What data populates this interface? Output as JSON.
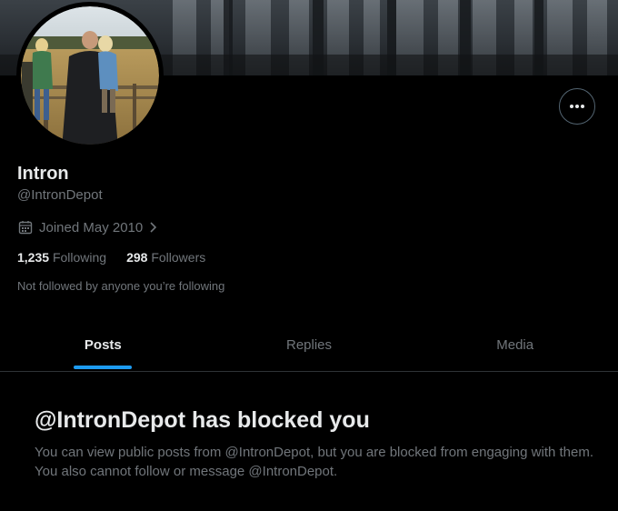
{
  "profile": {
    "display_name": "Intron",
    "handle": "@IntronDepot",
    "joined": "Joined May 2010",
    "following_count": "1,235",
    "following_label": "Following",
    "followers_count": "298",
    "followers_label": "Followers",
    "not_followed_text": "Not followed by anyone you’re following"
  },
  "tabs": [
    {
      "label": "Posts",
      "active": true
    },
    {
      "label": "Replies",
      "active": false
    },
    {
      "label": "Media",
      "active": false
    }
  ],
  "blocked": {
    "title": "@IntronDepot has blocked you",
    "body": "You can view public posts from @IntronDepot, but you are blocked from engaging with them. You also cannot follow or message @IntronDepot."
  },
  "icons": {
    "more": "more-icon",
    "calendar": "calendar-icon",
    "chevron": "chevron-right-icon"
  },
  "colors": {
    "background": "#000000",
    "text_primary": "#e7e9ea",
    "text_secondary": "#71767b",
    "accent": "#1d9bf0",
    "divider": "#2f3336"
  }
}
